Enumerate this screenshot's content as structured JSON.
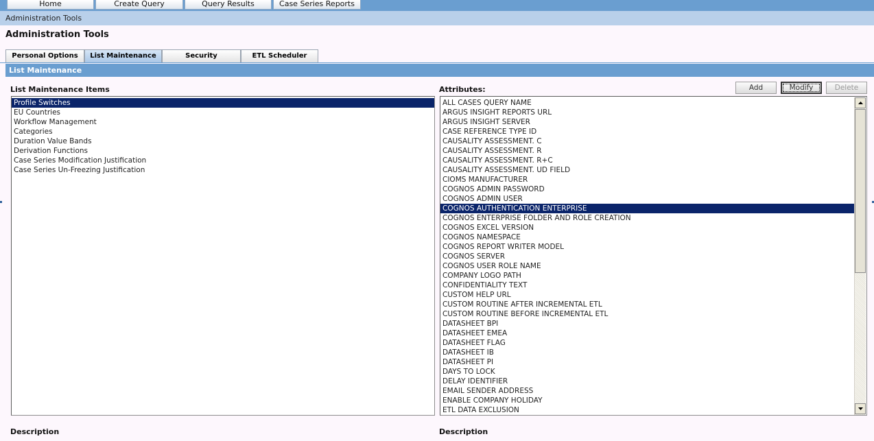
{
  "nav": {
    "buttons": [
      "Home",
      "Create Query",
      "Query Results",
      "Case Series Reports"
    ]
  },
  "breadcrumb": "Administration Tools",
  "page_title": "Administration Tools",
  "tabs": [
    "Personal Options",
    "List Maintenance",
    "Security",
    "ETL Scheduler"
  ],
  "active_tab": "List Maintenance",
  "section_header": "List Maintenance",
  "left_panel": {
    "label": "List Maintenance Items",
    "items": [
      "Profile Switches",
      "EU Countries",
      "Workflow Management",
      "Categories",
      "Duration Value Bands",
      "Derivation Functions",
      "Case Series Modification Justification",
      "Case Series Un-Freezing Justification"
    ],
    "selected": "Profile Switches"
  },
  "right_panel": {
    "label": "Attributes:",
    "buttons": {
      "add": "Add",
      "modify": "Modify",
      "delete": "Delete"
    },
    "items": [
      "ALL CASES QUERY NAME",
      "ARGUS INSIGHT REPORTS URL",
      "ARGUS INSIGHT SERVER",
      "CASE REFERENCE TYPE ID",
      "CAUSALITY ASSESSMENT. C",
      "CAUSALITY ASSESSMENT. R",
      "CAUSALITY ASSESSMENT. R+C",
      "CAUSALITY ASSESSMENT. UD FIELD",
      "CIOMS MANUFACTURER",
      "COGNOS ADMIN PASSWORD",
      "COGNOS ADMIN USER",
      "COGNOS AUTHENTICATION ENTERPRISE",
      "COGNOS ENTERPRISE FOLDER AND ROLE CREATION",
      "COGNOS EXCEL VERSION",
      "COGNOS NAMESPACE",
      "COGNOS REPORT WRITER MODEL",
      "COGNOS SERVER",
      "COGNOS USER ROLE NAME",
      "COMPANY LOGO PATH",
      "CONFIDENTIALITY TEXT",
      "CUSTOM HELP URL",
      "CUSTOM ROUTINE AFTER INCREMENTAL ETL",
      "CUSTOM ROUTINE BEFORE INCREMENTAL ETL",
      "DATASHEET BPI",
      "DATASHEET EMEA",
      "DATASHEET FLAG",
      "DATASHEET IB",
      "DATASHEET PI",
      "DAYS TO LOCK",
      "DELAY IDENTIFIER",
      "EMAIL SENDER ADDRESS",
      "ENABLE COMPANY HOLIDAY",
      "ETL DATA EXCLUSION"
    ],
    "selected": "COGNOS AUTHENTICATION ENTERPRISE",
    "scroll_position": 0
  },
  "description_left": "Description",
  "description_right": "Description",
  "colors": {
    "nav_bar": "#6a9ed0",
    "breadcrumb_bar": "#b9d0ea",
    "selection": "#0a246a",
    "page_bg": "#fdf7fd"
  }
}
